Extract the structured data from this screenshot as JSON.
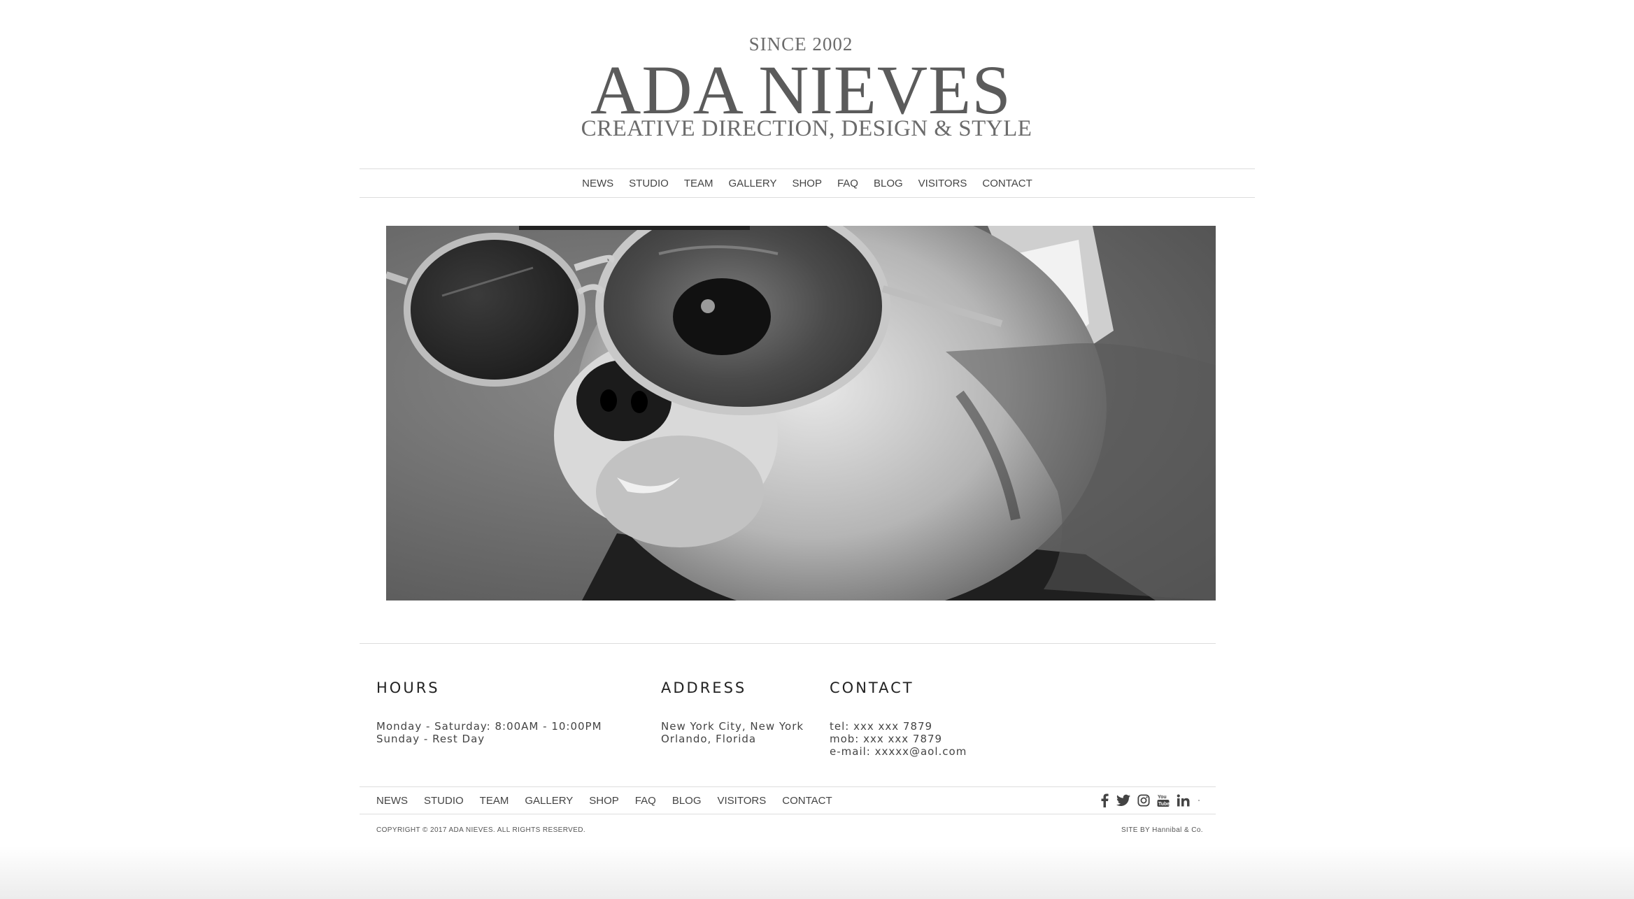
{
  "header": {
    "since": "SINCE 2002",
    "brand": "ADA NIEVES",
    "tagline": "CREATIVE DIRECTION, DESIGN & STYLE"
  },
  "nav": {
    "items": [
      "NEWS",
      "STUDIO",
      "TEAM",
      "GALLERY",
      "SHOP",
      "FAQ",
      "BLOG",
      "VISITORS",
      "CONTACT"
    ]
  },
  "hero": {
    "image": "black-and-white photo of a chihuahua wearing aviator sunglasses"
  },
  "info": {
    "hours": {
      "title": "HOURS",
      "lines": [
        "Monday - Saturday: 8:00AM - 10:00PM",
        "Sunday - Rest Day"
      ]
    },
    "address": {
      "title": "ADDRESS",
      "lines": [
        "New York City, New York",
        "Orlando, Florida"
      ]
    },
    "contact": {
      "title": "CONTACT",
      "lines": [
        "tel: xxx xxx 7879",
        "mob: xxx xxx 7879",
        "e-mail: xxxxx@aol.com"
      ]
    }
  },
  "footer": {
    "nav_items": [
      "NEWS",
      "STUDIO",
      "TEAM",
      "GALLERY",
      "SHOP",
      "FAQ",
      "BLOG",
      "VISITORS",
      "CONTACT"
    ],
    "social_icons": [
      "facebook-icon",
      "twitter-icon",
      "instagram-icon",
      "youtube-icon",
      "linkedin-icon"
    ],
    "copyright": "COPYRIGHT © 2017 ADA NIEVES. ALL RIGHTS RESERVED.",
    "credit": "SITE BY Hannibal & Co."
  },
  "colors": {
    "text": "#333333",
    "divider": "#dddddd",
    "brand": "#5b5b5b"
  }
}
